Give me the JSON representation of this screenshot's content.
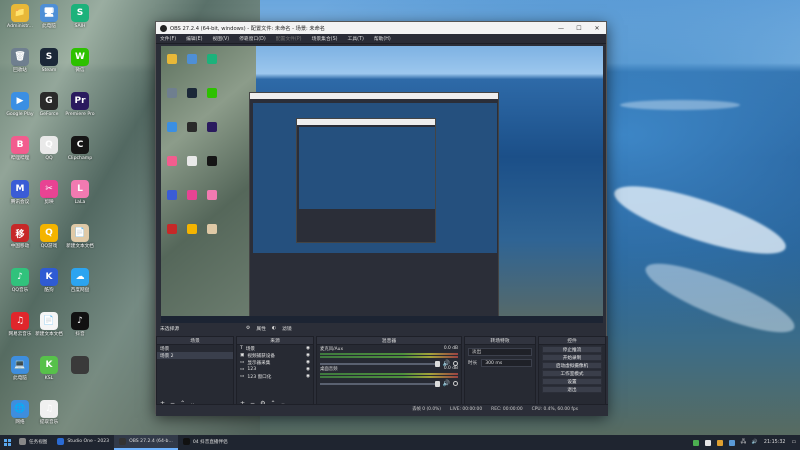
{
  "desktop": {
    "icons": [
      {
        "label": "Administr...",
        "color": "#e8b838",
        "glyph": "📁"
      },
      {
        "label": "此电脑",
        "color": "#4e8fd6",
        "glyph": "🖥"
      },
      {
        "label": "SAIH",
        "color": "#1cb27b",
        "glyph": "S"
      },
      {
        "label": "回收站",
        "color": "#6f7f8f",
        "glyph": "🗑"
      },
      {
        "label": "Steam",
        "color": "#1b2838",
        "glyph": "S"
      },
      {
        "label": "微信",
        "color": "#2dc100",
        "glyph": "W"
      },
      {
        "label": "Google Play",
        "color": "#3b8fe3",
        "glyph": "▶"
      },
      {
        "label": "GeForce",
        "color": "#2a2a2a",
        "glyph": "G"
      },
      {
        "label": "Premiere Pro",
        "color": "#2a1a5e",
        "glyph": "Pr"
      },
      {
        "label": "哔哩哔哩",
        "color": "#f25d8e",
        "glyph": "B"
      },
      {
        "label": "QQ",
        "color": "#e9e9e9",
        "glyph": "Q"
      },
      {
        "label": "Clipchamp",
        "color": "#151515",
        "glyph": "C"
      },
      {
        "label": "腾讯会议",
        "color": "#3a5cd6",
        "glyph": "M"
      },
      {
        "label": "剪映",
        "color": "#e84393",
        "glyph": "✂"
      },
      {
        "label": "LaLa",
        "color": "#f27ab1",
        "glyph": "L"
      },
      {
        "label": "中国移动",
        "color": "#c62828",
        "glyph": "移"
      },
      {
        "label": "QQ游戏",
        "color": "#f4b400",
        "glyph": "Q"
      },
      {
        "label": "新建文本文档",
        "color": "#dfc9a6",
        "glyph": "📄"
      },
      {
        "label": "QQ音乐",
        "color": "#31c27c",
        "glyph": "♪"
      },
      {
        "label": "酷狗",
        "color": "#2f5bd3",
        "glyph": "K"
      },
      {
        "label": "百度网盘",
        "color": "#2ca4f0",
        "glyph": "☁"
      },
      {
        "label": "网易云音乐",
        "color": "#e0262c",
        "glyph": "♫"
      },
      {
        "label": "新建文本文档",
        "color": "#f5f5f5",
        "glyph": "📄"
      },
      {
        "label": "抖音",
        "color": "#111111",
        "glyph": "♪"
      },
      {
        "label": "此电脑",
        "color": "#3e8ede",
        "glyph": "💻"
      },
      {
        "label": "KSL",
        "color": "#57c14a",
        "glyph": "K"
      },
      {
        "label": "",
        "color": "#3a3a3a",
        "glyph": ""
      },
      {
        "label": "网络",
        "color": "#3e8ede",
        "glyph": "🌐"
      },
      {
        "label": "提取音乐",
        "color": "#f0f0f0",
        "glyph": "♫"
      }
    ]
  },
  "obs": {
    "title": "OBS 27.2.4 (64-bit, windows) - 配置文件: 未命名 - 场景: 未命名",
    "menu": [
      "文件(F)",
      "编辑(E)",
      "视图(V)",
      "停靠窗口(D)",
      "配置文件(P)",
      "场景集合(S)",
      "工具(T)",
      "帮助(H)"
    ],
    "menu_dimmed_index": 4,
    "dock_label": "未选择源",
    "props_button": "属性",
    "filters_button": "滤镜",
    "scenes": {
      "title": "场景",
      "items": [
        "场景",
        "场景 2"
      ],
      "selected": 1
    },
    "sources": {
      "title": "来源",
      "items": [
        "场景",
        "视频捕获设备",
        "显示器采集",
        "123",
        "123 窗口化"
      ]
    },
    "mixer": {
      "title": "混音器",
      "tracks": [
        {
          "name": "麦克风/Aux",
          "db": "0.0 dB"
        },
        {
          "name": "桌面音频",
          "db": "0.0 dB"
        }
      ]
    },
    "transitions": {
      "title": "转场特效",
      "type": "淡出",
      "duration_label": "时长",
      "duration_value": "300 ms"
    },
    "controls": {
      "title": "控件",
      "buttons": [
        "停止推流",
        "开始录制",
        "启动虚拟摄像机",
        "工作室模式",
        "设置",
        "退出"
      ]
    },
    "status": {
      "dropped": "丢帧 0 (0.0%)",
      "live": "LIVE: 00:00:00",
      "rec": "REC: 00:00:00",
      "cpu": "CPU: 0.4%, 60.00 fps"
    }
  },
  "taskbar": {
    "items": [
      {
        "label": "任务视图",
        "color": "#888888"
      },
      {
        "label": "Studio One - 2023",
        "color": "#2b6bd3"
      },
      {
        "label": "OBS 27.2.4 (64-b...",
        "color": "#333333"
      },
      {
        "label": "04 抖音直播伴侣",
        "color": "#111111"
      }
    ],
    "active_index": 2,
    "clock": "21:15:32"
  }
}
